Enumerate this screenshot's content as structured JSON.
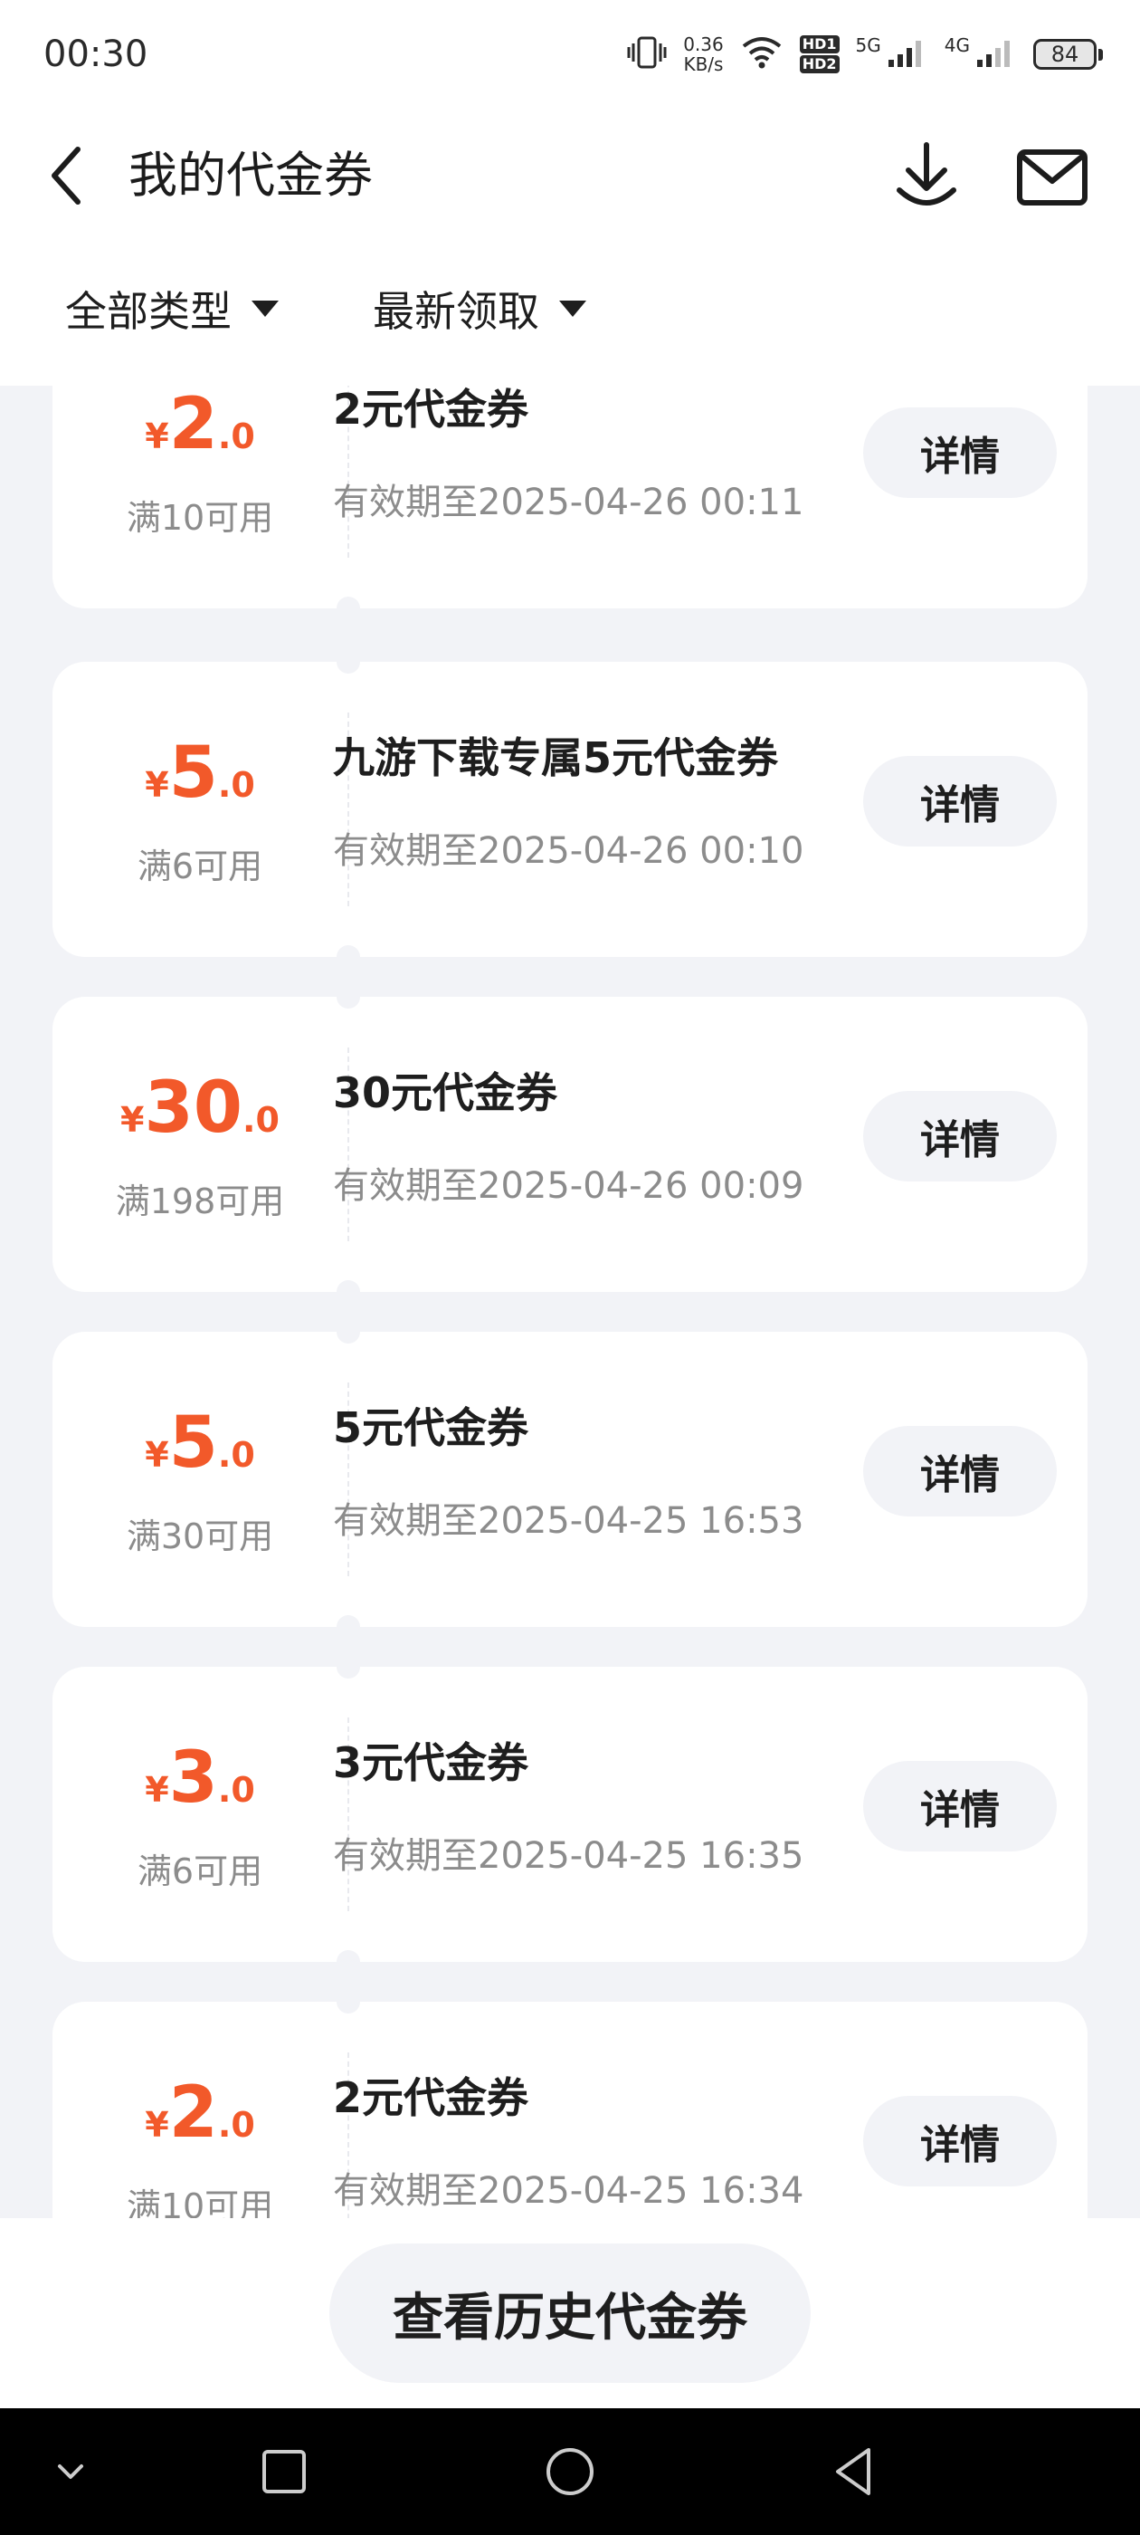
{
  "status_bar": {
    "time": "00:30",
    "net_speed_value": "0.36",
    "net_speed_unit": "KB/s",
    "hd_label_1": "HD1",
    "hd_label_2": "HD2",
    "signal_1": "5G",
    "signal_2": "4G",
    "battery": "84"
  },
  "header": {
    "title": "我的代金券",
    "icons": [
      "back-arrow",
      "download",
      "mail"
    ]
  },
  "filters": {
    "type_label": "全部类型",
    "sort_label": "最新领取"
  },
  "coupons": [
    {
      "currency": "¥",
      "amount_int": "2",
      "amount_dec": ".0",
      "condition": "满10可用",
      "title": "2元代金券",
      "expiry": "有效期至2025-04-26 00:11",
      "button": "详情"
    },
    {
      "currency": "¥",
      "amount_int": "5",
      "amount_dec": ".0",
      "condition": "满6可用",
      "title": "九游下载专属5元代金券",
      "expiry": "有效期至2025-04-26 00:10",
      "button": "详情"
    },
    {
      "currency": "¥",
      "amount_int": "30",
      "amount_dec": ".0",
      "condition": "满198可用",
      "title": "30元代金券",
      "expiry": "有效期至2025-04-26 00:09",
      "button": "详情"
    },
    {
      "currency": "¥",
      "amount_int": "5",
      "amount_dec": ".0",
      "condition": "满30可用",
      "title": "5元代金券",
      "expiry": "有效期至2025-04-25 16:53",
      "button": "详情"
    },
    {
      "currency": "¥",
      "amount_int": "3",
      "amount_dec": ".0",
      "condition": "满6可用",
      "title": "3元代金券",
      "expiry": "有效期至2025-04-25 16:35",
      "button": "详情"
    },
    {
      "currency": "¥",
      "amount_int": "2",
      "amount_dec": ".0",
      "condition": "满10可用",
      "title": "2元代金券",
      "expiry": "有效期至2025-04-25 16:34",
      "button": "详情"
    }
  ],
  "footer": {
    "history_button": "查看历史代金券"
  },
  "colors": {
    "accent": "#f2592a",
    "background": "#f2f3f7",
    "muted_text": "#8c8c8c"
  }
}
